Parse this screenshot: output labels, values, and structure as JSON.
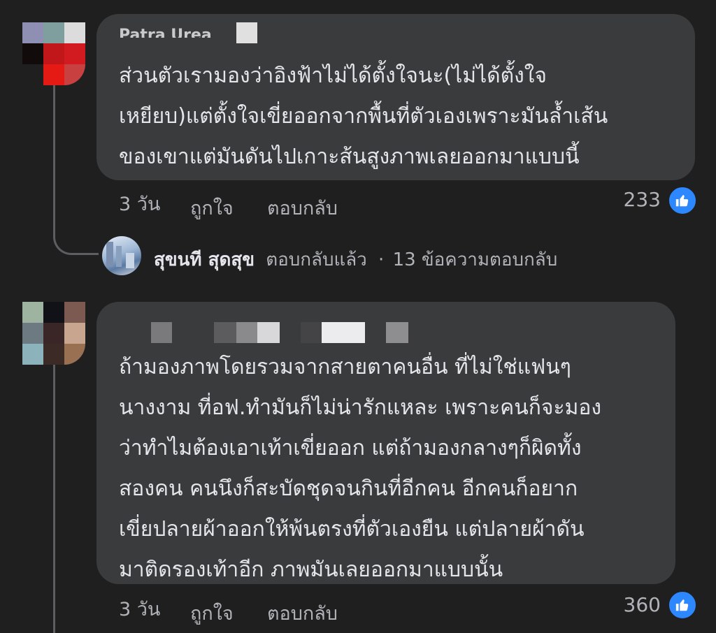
{
  "comments": [
    {
      "author": "Patra Urea",
      "text": "ส่วนตัวเรามองว่าอิงฟ้าไม่ได้ตั้งใจนะ(ไม่ได้ตั้งใจ\nเหยียบ)แต่ตั้งใจเขี่ยออกจากพื้นที่ตัวเองเพราะมันล้ำเส้น\nของเขาแต่มันดันไปเกาะส้นสูงภาพเลยออกมาแบบนี้",
      "time": "3 วัน",
      "like_label": "ถูกใจ",
      "reply_label": "ตอบกลับ",
      "reaction_count": "233",
      "reaction_icon": "thumbs-up-icon"
    },
    {
      "author": "",
      "text": "ถ้ามองภาพโดยรวมจากสายตาคนอื่น ที่ไม่ใช่แฟนๆ\nนางงาม ที่อฟ.ทำมันก็ไม่น่ารักแหละ เพราะคนก็จะมอง\nว่าทำไมต้องเอาเท้าเขี่ยออก แต่ถ้ามองกลางๆก็ผิดทั้ง\nสองคน คนนึงก็สะบัดชุดจนกินที่อีกคน อีกคนก็อยาก\nเขี่ยปลายผ้าออกให้พ้นตรงที่ตัวเองยืน แต่ปลายผ้าดัน\nมาติดรองเท้าอีก ภาพมันเลยออกมาแบบนั้น",
      "time": "3 วัน",
      "like_label": "ถูกใจ",
      "reply_label": "ตอบกลับ",
      "reaction_count": "360",
      "reaction_icon": "thumbs-up-icon"
    }
  ],
  "reply_summary": {
    "name": "สุขนที สุดสุข",
    "action": "ตอบกลับแล้ว",
    "separator": "·",
    "count_text": "13 ข้อความตอบกลับ"
  },
  "colors": {
    "background": "#1f1f20",
    "bubble": "#3a3b3c",
    "text": "#e4e6eb",
    "secondary_text": "#b0b3b8",
    "like_blue": "#2d88ff"
  }
}
